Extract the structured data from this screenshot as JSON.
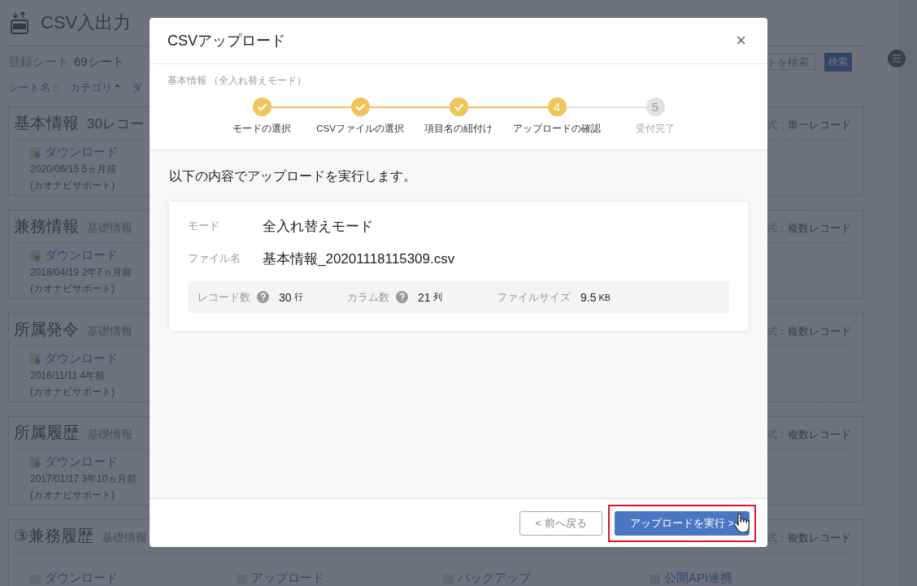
{
  "page": {
    "title": "CSV入出力",
    "count_label": "登録シート",
    "count_value": "69シート",
    "sort_links": [
      {
        "label": "シート名",
        "sorted": false
      },
      {
        "label": "カテゴリ",
        "sorted": true
      },
      {
        "label": "ダ"
      }
    ],
    "search": {
      "placeholder": "トを検索",
      "button": "検索"
    },
    "sheets": [
      {
        "title": "基本情報",
        "count": "30レコー",
        "form_label": "式：",
        "form_value": "単一レコード",
        "link": "ダウンロード",
        "date": "2020/06/15 5ヵ月前",
        "author": "(カオナビサポート)"
      },
      {
        "title": "兼務情報",
        "category": "基礎情報",
        "form_label": "式：",
        "form_value": "複数レコード",
        "link": "ダウンロード",
        "date": "2018/04/19 2年7ヵ月前",
        "author": "(カオナビサポート)"
      },
      {
        "title": "所属発令",
        "category": "基礎情報",
        "form_label": "式：",
        "form_value": "複数レコード",
        "link": "ダウンロード",
        "date": "2016/11/11 4年前",
        "author": "(カオナビサポート)"
      },
      {
        "title": "所属履歴",
        "category": "基礎情報",
        "form_label": "式：",
        "form_value": "複数レコード",
        "link": "ダウンロード",
        "date": "2017/01/17 3年10ヵ月前",
        "author": "(カオナビサポート)"
      },
      {
        "title": "③兼務履歴",
        "category": "基礎情報",
        "form_label": "式：",
        "form_value": "複数レコード",
        "actions": [
          "ダウンロード",
          "アップロード",
          "バックアップ",
          "公開API連携"
        ]
      }
    ]
  },
  "dialog": {
    "title": "CSVアップロード",
    "close": "×",
    "subtitle": "基本情報 （全入れ替えモード）",
    "steps": [
      {
        "label": "モードの選択",
        "done": true
      },
      {
        "label": "CSVファイルの選択",
        "done": true
      },
      {
        "label": "項目名の紐付け",
        "done": true
      },
      {
        "label": "アップロードの確認",
        "number": "4",
        "done": false,
        "current": true
      },
      {
        "label": "受付完了",
        "number": "5",
        "done": false,
        "current": false
      }
    ],
    "message": "以下の内容でアップロードを実行します。",
    "fields": [
      {
        "label": "モード",
        "value": "全入れ替えモード"
      },
      {
        "label": "ファイル名",
        "value": "基本情報_20201118115309.csv"
      }
    ],
    "stats": [
      {
        "label": "レコード数",
        "help": true,
        "value": "30",
        "unit": "行"
      },
      {
        "label": "カラム数",
        "help": true,
        "value": "21",
        "unit": "列"
      },
      {
        "label": "ファイルサイズ",
        "help": false,
        "value": "9.5",
        "unit": "KB"
      }
    ],
    "back_button": "< 前へ戻る",
    "submit_button": "アップロードを実行 >",
    "submit_highlighted": true
  }
}
